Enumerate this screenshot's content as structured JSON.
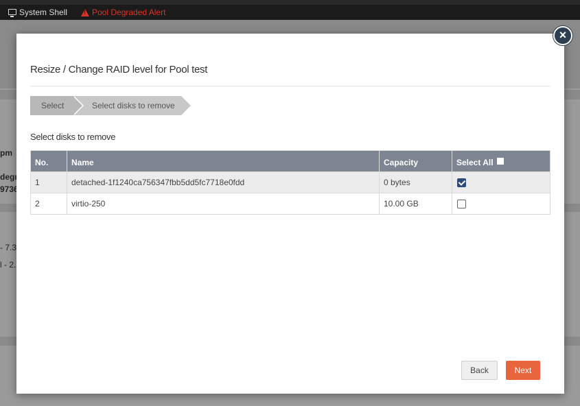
{
  "topbar": {
    "shell_label": "System Shell",
    "alert_label": "Pool Degraded Alert"
  },
  "background": {
    "fragments": [
      "pm",
      "degra",
      "9736",
      "- 7.3",
      "l - 2."
    ]
  },
  "modal": {
    "title": "Resize / Change RAID level for Pool test",
    "close_glyph": "×",
    "steps": [
      "Select",
      "Select disks to remove"
    ],
    "section_label": "Select disks to remove",
    "table": {
      "headers": [
        "No.",
        "Name",
        "Capacity",
        "Select All"
      ],
      "rows": [
        {
          "no": "1",
          "name": "detached-1f1240ca756347fbb5dd5fc7718e0fdd",
          "capacity": "0 bytes",
          "selected": true
        },
        {
          "no": "2",
          "name": "virtio-250",
          "capacity": "10.00 GB",
          "selected": false
        }
      ]
    },
    "buttons": {
      "back": "Back",
      "next": "Next"
    }
  },
  "colors": {
    "header_bg": "#7d8492",
    "accent_next": "#e8643c",
    "alert_red": "#d9342b",
    "checkbox_checked": "#2e4a7a"
  }
}
